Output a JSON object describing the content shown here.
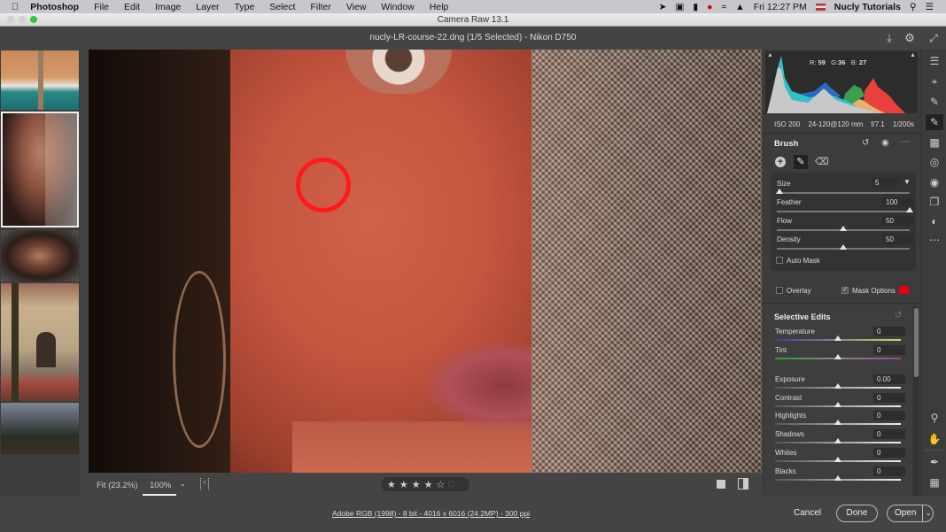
{
  "menubar": {
    "app": "Photoshop",
    "items": [
      "File",
      "Edit",
      "Image",
      "Layer",
      "Type",
      "Select",
      "Filter",
      "View",
      "Window",
      "Help"
    ],
    "clock": "Fri 12:27 PM",
    "user": "Nucly Tutorials"
  },
  "window": {
    "title": "Camera Raw 13.1",
    "document_title": "nucly-LR-course-22.dng (1/5 Selected)  -  Nikon D750"
  },
  "histogram": {
    "r_label": "R:",
    "r": "59",
    "g_label": "G:",
    "g": "36",
    "b_label": "B:",
    "b": "27"
  },
  "camera_info": {
    "iso": "ISO 200",
    "lens": "24-120@120 mm",
    "aperture": "f/7.1",
    "shutter": "1/200s"
  },
  "brush": {
    "title": "Brush",
    "size_label": "Size",
    "size": "5",
    "size_pos": 0.02,
    "feather_label": "Feather",
    "feather": "100",
    "feather_pos": 1.0,
    "flow_label": "Flow",
    "flow": "50",
    "flow_pos": 0.5,
    "density_label": "Density",
    "density": "50",
    "density_pos": 0.5,
    "auto_mask_label": "Auto Mask",
    "auto_mask": false,
    "overlay_label": "Overlay",
    "overlay": false,
    "mask_options_label": "Mask Options",
    "mask_options": true,
    "mask_color": "#e8000a"
  },
  "selective_edits": {
    "title": "Selective Edits",
    "sliders": [
      {
        "label": "Temperature",
        "value": "0",
        "pos": 0.5
      },
      {
        "label": "Tint",
        "value": "0",
        "pos": 0.5
      },
      {
        "label": "Exposure",
        "value": "0.00",
        "pos": 0.5
      },
      {
        "label": "Contrast",
        "value": "0",
        "pos": 0.5
      },
      {
        "label": "Highlights",
        "value": "0",
        "pos": 0.5
      },
      {
        "label": "Shadows",
        "value": "0",
        "pos": 0.5
      },
      {
        "label": "Whites",
        "value": "0",
        "pos": 0.5
      },
      {
        "label": "Blacks",
        "value": "0",
        "pos": 0.5
      }
    ]
  },
  "viewbar": {
    "fit_label": "Fit (23.2%)",
    "zoom_label": "100%",
    "rating": 4,
    "rating_max": 5
  },
  "bottombar": {
    "workflow_link": "Adobe RGB (1998) - 8 bit - 4016 x 6016 (24.2MP) - 300 ppi",
    "cancel_label": "Cancel",
    "done_label": "Done",
    "open_label": "Open"
  },
  "filmstrip": {
    "count": 5,
    "selected_index": 1
  }
}
